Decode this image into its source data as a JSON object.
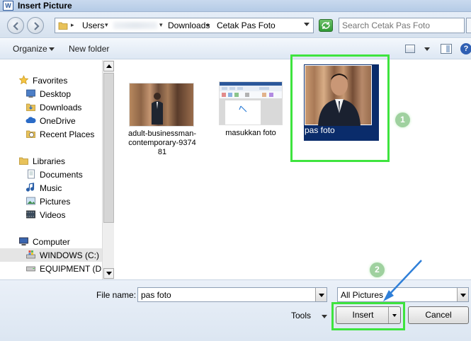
{
  "window": {
    "title": "Insert Picture",
    "app_icon_letter": "W"
  },
  "address_bar": {
    "crumbs": [
      "Users",
      "Downloads",
      "Cetak Pas Foto"
    ],
    "search_placeholder": "Search Cetak Pas Foto"
  },
  "toolbar": {
    "organize": "Organize",
    "new_folder": "New folder",
    "help": "?"
  },
  "nav": {
    "favorites_label": "Favorites",
    "favorites": [
      "Desktop",
      "Downloads",
      "OneDrive",
      "Recent Places"
    ],
    "libraries_label": "Libraries",
    "libraries": [
      "Documents",
      "Music",
      "Pictures",
      "Videos"
    ],
    "computer_label": "Computer",
    "drives": [
      "WINDOWS (C:)",
      "EQUIPMENT (D:)"
    ]
  },
  "files": [
    {
      "name": "adult-businessman-contemporary-937481",
      "caption_lines": [
        "adult-businessman-",
        "contemporary-9374",
        "81"
      ],
      "icon": "photo-businessman-icon"
    },
    {
      "name": "masukkan foto",
      "caption_lines": [
        "masukkan foto"
      ],
      "icon": "screenshot-thumbnail-icon"
    },
    {
      "name": "pas foto",
      "caption_lines": [
        "pas foto"
      ],
      "icon": "photo-portrait-icon",
      "selected": true
    }
  ],
  "annotations": {
    "step1": "1",
    "step2": "2",
    "highlight_color": "#3ee43e",
    "arrow_color": "#2f7fd8"
  },
  "bottom": {
    "file_name_label": "File name:",
    "file_name_value": "pas foto",
    "file_type": "All Pictures",
    "tools": "Tools",
    "insert": "Insert",
    "cancel": "Cancel"
  },
  "colors": {
    "selection": "#0a2c6b",
    "titlebar": "#c9d9ee"
  }
}
